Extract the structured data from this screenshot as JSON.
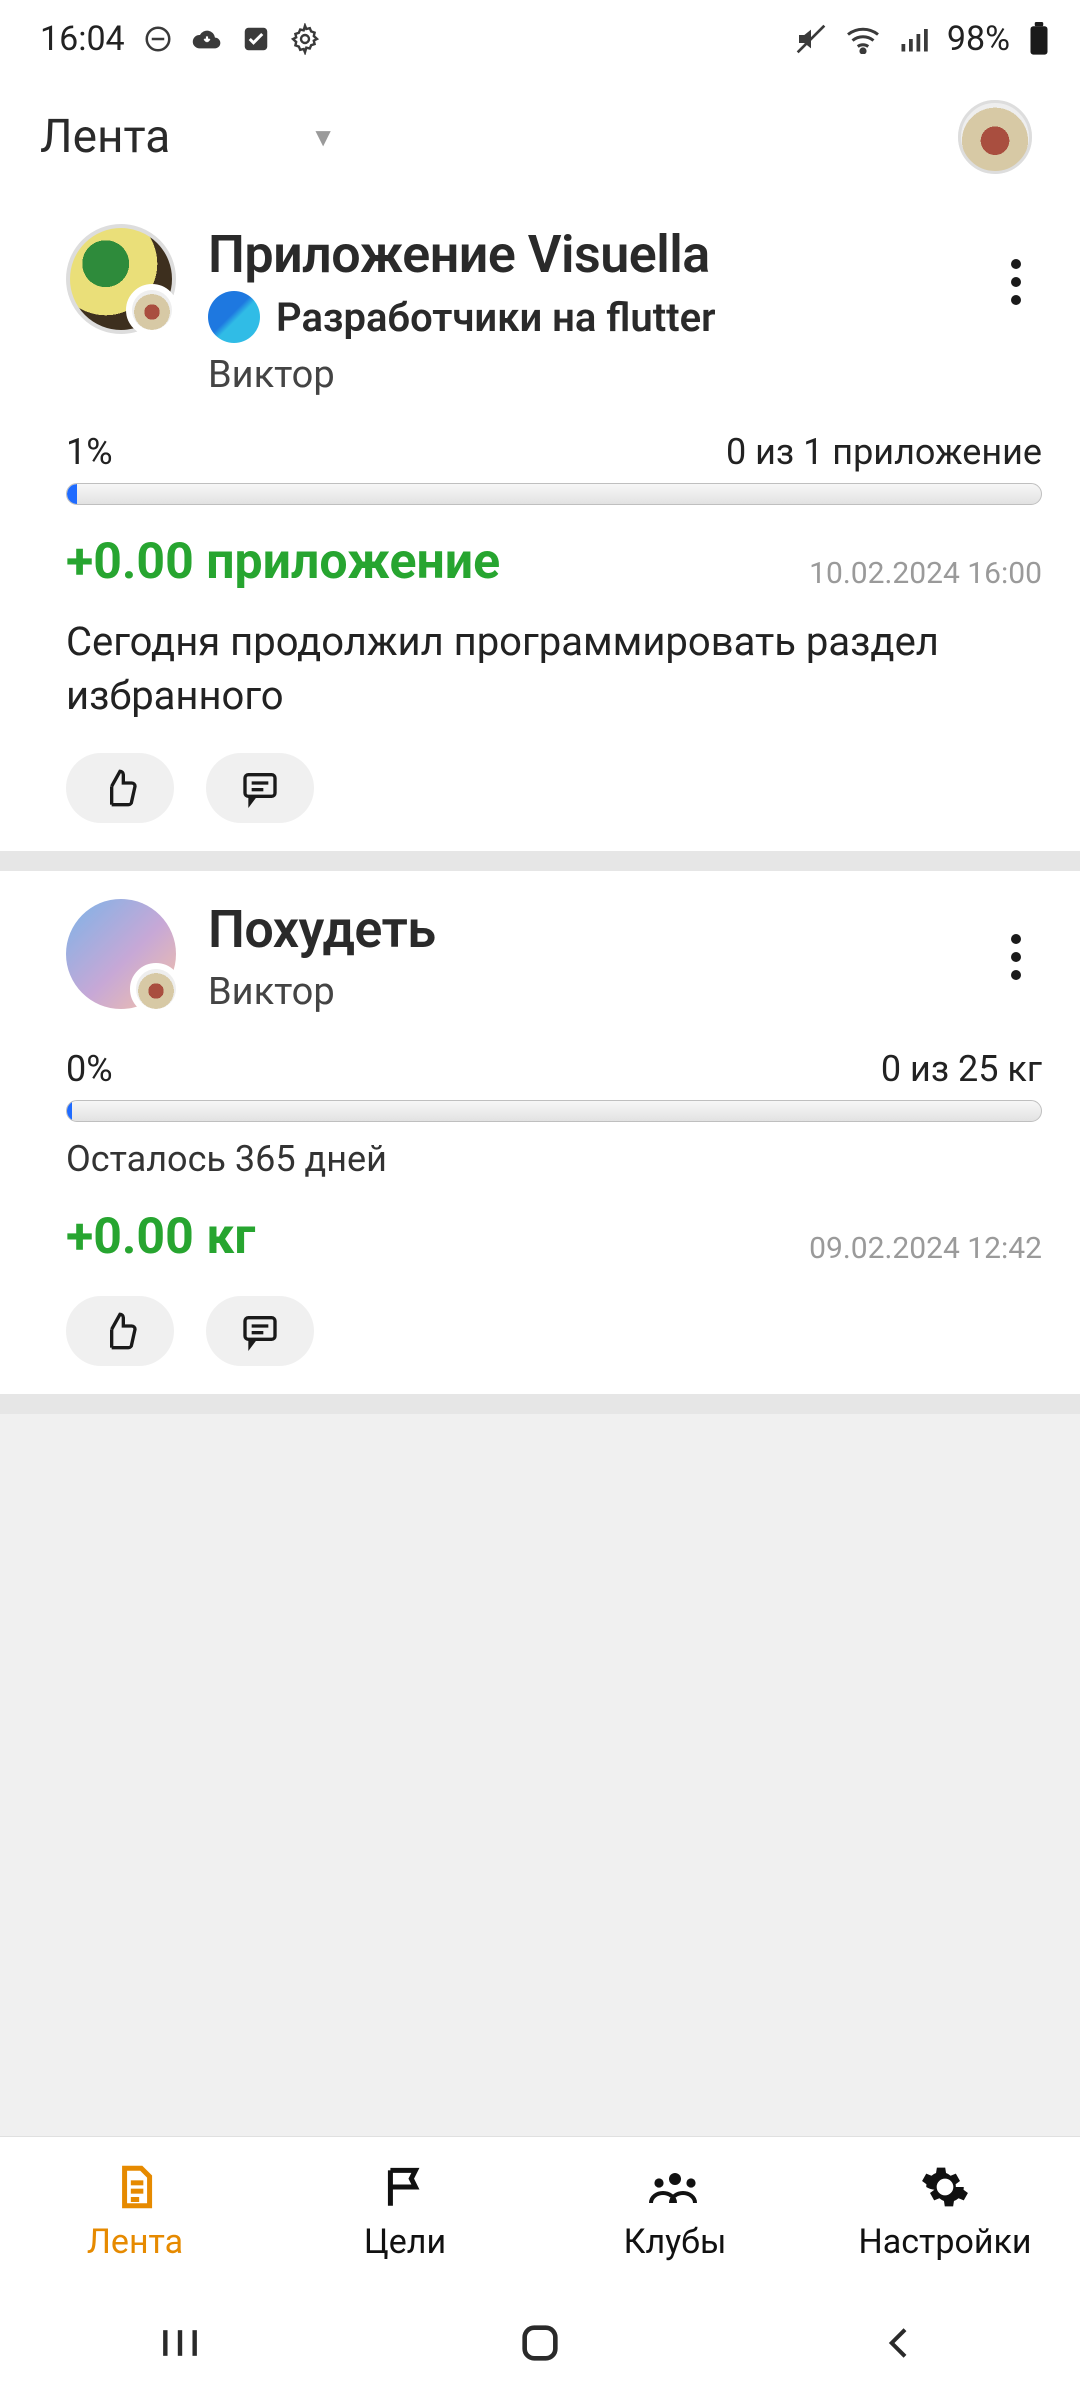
{
  "statusbar": {
    "time": "16:04",
    "battery_pct": "98%"
  },
  "topbar": {
    "dropdown_label": "Лента"
  },
  "posts": [
    {
      "title": "Приложение  Visuella",
      "subtitle": "Разработчики на flutter",
      "author": "Виктор",
      "progress_pct_label": "1%",
      "progress_pct": 1,
      "progress_of": "0 из 1 приложение",
      "delta": "+0.00 приложение",
      "timestamp": "10.02.2024 16:00",
      "text": "Сегодня продолжил программировать раздел избранного"
    },
    {
      "title": "Похудеть",
      "author": "Виктор",
      "progress_pct_label": "0%",
      "progress_pct": 0.5,
      "progress_of": "0 из 25 кг",
      "days_left": "Осталось 365 дней",
      "delta": "+0.00 кг",
      "timestamp": "09.02.2024 12:42"
    }
  ],
  "bottomnav": {
    "feed": "Лента",
    "goals": "Цели",
    "clubs": "Клубы",
    "settings": "Настройки"
  }
}
